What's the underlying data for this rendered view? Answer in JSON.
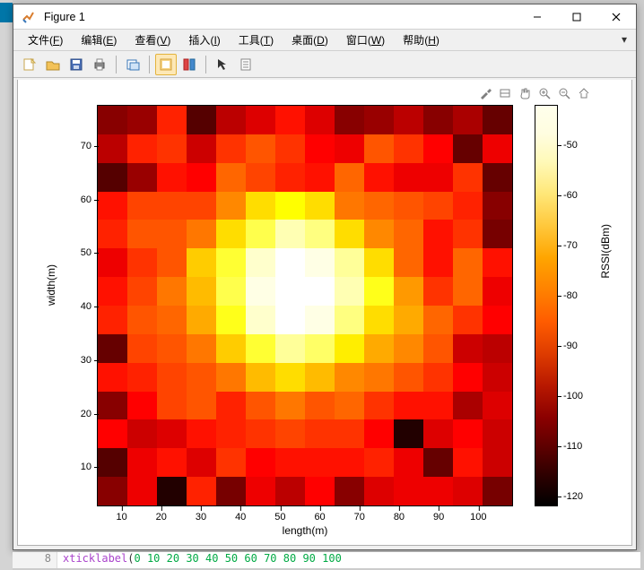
{
  "window": {
    "title": "Figure 1",
    "min_label": "—",
    "max_label": "☐",
    "close_label": "✕"
  },
  "menu": {
    "items": [
      {
        "label": "文件",
        "accel": "F"
      },
      {
        "label": "编辑",
        "accel": "E"
      },
      {
        "label": "查看",
        "accel": "V"
      },
      {
        "label": "插入",
        "accel": "I"
      },
      {
        "label": "工具",
        "accel": "T"
      },
      {
        "label": "桌面",
        "accel": "D"
      },
      {
        "label": "窗口",
        "accel": "W"
      },
      {
        "label": "帮助",
        "accel": "H"
      }
    ],
    "dropdown_glyph": "▾"
  },
  "toolbar": {
    "icons": {
      "new": "new-figure-icon",
      "open": "open-icon",
      "save": "save-icon",
      "print": "print-icon",
      "sendto": "send-to-icon",
      "datacursor": "data-cursor-icon",
      "linked": "linked-plot-icon",
      "arrow": "arrow-icon",
      "insert": "insert-colorbar-icon"
    }
  },
  "plot_tools": {
    "brush": "brush-icon",
    "span": "span-icon",
    "pan": "pan-icon",
    "zoomin": "zoom-in-icon",
    "zoomout": "zoom-out-icon",
    "home": "home-icon"
  },
  "chart_data": {
    "type": "heatmap",
    "xlabel": "length(m)",
    "ylabel": "width(m)",
    "colorbar_label": "RSSI(dBm)",
    "x_ticks": [
      10,
      20,
      30,
      40,
      50,
      60,
      70,
      80,
      90,
      100
    ],
    "y_ticks": [
      10,
      20,
      30,
      40,
      50,
      60,
      70
    ],
    "colorbar_ticks": [
      -50,
      -60,
      -70,
      -80,
      -90,
      -100,
      -110,
      -120
    ],
    "colorbar_range": [
      -122,
      -42
    ],
    "x_range_cells": [
      1,
      14
    ],
    "y_range_cells": [
      1,
      14
    ],
    "grid": [
      [
        -106,
        -104,
        -88,
        -112,
        -100,
        -96,
        -90,
        -96,
        -106,
        -104,
        -100,
        -106,
        -102,
        -110
      ],
      [
        -100,
        -88,
        -86,
        -98,
        -86,
        -82,
        -86,
        -92,
        -94,
        -82,
        -86,
        -92,
        -110,
        -94
      ],
      [
        -112,
        -104,
        -90,
        -92,
        -80,
        -84,
        -88,
        -90,
        -80,
        -90,
        -94,
        -94,
        -86,
        -110
      ],
      [
        -90,
        -84,
        -84,
        -84,
        -76,
        -66,
        -62,
        -66,
        -78,
        -80,
        -82,
        -84,
        -88,
        -106
      ],
      [
        -88,
        -82,
        -82,
        -78,
        -66,
        -56,
        -48,
        -52,
        -66,
        -76,
        -80,
        -90,
        -86,
        -108
      ],
      [
        -94,
        -86,
        -82,
        -68,
        -58,
        -46,
        -42,
        -44,
        -50,
        -66,
        -80,
        -90,
        -80,
        -90
      ],
      [
        -90,
        -84,
        -78,
        -70,
        -56,
        -44,
        -42,
        -42,
        -48,
        -60,
        -74,
        -86,
        -80,
        -94
      ],
      [
        -88,
        -82,
        -80,
        -72,
        -60,
        -46,
        -42,
        -44,
        -52,
        -66,
        -72,
        -80,
        -86,
        -92
      ],
      [
        -110,
        -84,
        -82,
        -78,
        -68,
        -58,
        -50,
        -54,
        -64,
        -72,
        -76,
        -82,
        -98,
        -100
      ],
      [
        -90,
        -88,
        -84,
        -82,
        -78,
        -70,
        -66,
        -70,
        -76,
        -78,
        -82,
        -86,
        -92,
        -98
      ],
      [
        -106,
        -92,
        -84,
        -82,
        -88,
        -82,
        -78,
        -82,
        -80,
        -86,
        -90,
        -90,
        -102,
        -96
      ],
      [
        -92,
        -98,
        -96,
        -90,
        -88,
        -86,
        -84,
        -86,
        -86,
        -92,
        -118,
        -96,
        -92,
        -98
      ],
      [
        -112,
        -94,
        -90,
        -96,
        -86,
        -92,
        -90,
        -90,
        -90,
        -88,
        -94,
        -110,
        -90,
        -98
      ],
      [
        -106,
        -94,
        -118,
        -88,
        -108,
        -94,
        -100,
        -92,
        -106,
        -96,
        -94,
        -94,
        -96,
        -108
      ]
    ]
  },
  "code_strip": {
    "gutter": "8",
    "keyword": "xticklabel",
    "rest_parts": [
      "(",
      "0",
      " ",
      "10",
      " ",
      "20",
      " ",
      "30",
      " ",
      "40",
      " ",
      "50",
      " ",
      "60",
      " ",
      "70",
      " ",
      "80",
      " ",
      "90",
      " ",
      "100"
    ]
  }
}
